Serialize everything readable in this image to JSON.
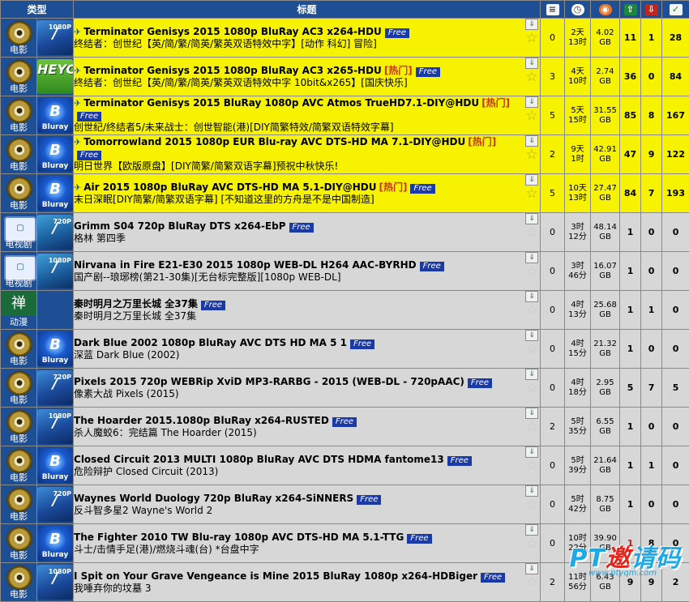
{
  "header": {
    "type_label": "类型",
    "title_label": "标题",
    "icon_names": [
      "comments-icon",
      "time-icon",
      "size-icon",
      "seeders-icon",
      "leechers-icon",
      "completed-icon"
    ]
  },
  "free_label": "Free",
  "hot_label": "[热门]",
  "rows": [
    {
      "style": "sticky",
      "cat": "movie",
      "cat_label": "电影",
      "fmt": "movies",
      "fmt_text": "1080P",
      "pinned": true,
      "title": "Terminator Genisys 2015 1080p BluRay AC3 x264-HDU",
      "hot": false,
      "free": true,
      "subtitle": "终结者：创世纪【英/简/繁/简英/繁英双语特效中字】[动作 科幻] 冒险]",
      "comments": "0",
      "time1": "2天",
      "time2": "13时",
      "size1": "4.02",
      "size2": "GB",
      "seeders": "11",
      "leechers": "1",
      "completed": "28"
    },
    {
      "style": "sticky",
      "cat": "movie",
      "cat_label": "电影",
      "fmt": "heyc",
      "fmt_text": "HEYC",
      "pinned": true,
      "title": "Terminator Genisys 2015 1080p BluRay AC3 x265-HDU",
      "hot": true,
      "free": true,
      "subtitle": "终结者：创世纪【英/简/繁/简英/繁英双语特效中字 10bit&x265】[国庆快乐]",
      "comments": "3",
      "time1": "4天",
      "time2": "10时",
      "size1": "2.74",
      "size2": "GB",
      "seeders": "36",
      "leechers": "0",
      "completed": "84"
    },
    {
      "style": "sticky",
      "cat": "movie",
      "cat_label": "电影",
      "fmt": "bluray",
      "fmt_text": "Bluray",
      "pinned": true,
      "title": "Terminator Genisys 2015 BluRay 1080p AVC Atmos TrueHD7.1-DIY@HDU",
      "hot": true,
      "free": true,
      "subtitle": "创世纪/终结者5/未来战士：创世智能(港)[DIY简繁特效/简繁双语特效字幕]",
      "comments": "5",
      "time1": "5天",
      "time2": "15时",
      "size1": "31.55",
      "size2": "GB",
      "seeders": "85",
      "leechers": "8",
      "completed": "167"
    },
    {
      "style": "sticky",
      "cat": "movie",
      "cat_label": "电影",
      "fmt": "bluray",
      "fmt_text": "Bluray",
      "pinned": true,
      "title": "Tomorrowland 2015 1080p EUR Blu-ray AVC DTS-HD MA 7.1-DIY@HDU",
      "hot": true,
      "free": true,
      "subtitle": "明日世界【欧版原盘】[DIY简繁/简繁双语字幕]预祝中秋快乐!",
      "comments": "2",
      "time1": "9天",
      "time2": "1时",
      "size1": "42.91",
      "size2": "GB",
      "seeders": "47",
      "leechers": "9",
      "completed": "122"
    },
    {
      "style": "sticky",
      "cat": "movie",
      "cat_label": "电影",
      "fmt": "bluray",
      "fmt_text": "Bluray",
      "pinned": true,
      "title": "Air 2015 1080p BluRay AVC DTS-HD MA 5.1-DIY@HDU",
      "hot": true,
      "free": true,
      "subtitle": "末日深眠[DIY简繁/简繁双语字幕] [不知道这里的方舟是不是中国制造]",
      "comments": "5",
      "time1": "10天",
      "time2": "13时",
      "size1": "27.47",
      "size2": "GB",
      "seeders": "84",
      "leechers": "7",
      "completed": "193"
    },
    {
      "style": "normal",
      "cat": "tv",
      "cat_label": "电视剧",
      "fmt": "tv",
      "fmt_text": "720P",
      "pinned": false,
      "title": "Grimm S04 720p BluRay DTS x264-EbP",
      "hot": false,
      "free": true,
      "subtitle": "格林 第四季",
      "comments": "0",
      "time1": "3时",
      "time2": "12分",
      "size1": "48.14",
      "size2": "GB",
      "seeders": "1",
      "leechers": "0",
      "completed": "0"
    },
    {
      "style": "normal",
      "cat": "tv",
      "cat_label": "电视剧",
      "fmt": "tv",
      "fmt_text": "1080P",
      "pinned": false,
      "title": "Nirvana in Fire E21-E30 2015 1080p WEB-DL H264 AAC-BYRHD",
      "hot": false,
      "free": true,
      "subtitle": "国产剧--琅琊榜(第21-30集)[无台标完整版][1080p WEB-DL]",
      "comments": "0",
      "time1": "3时",
      "time2": "46分",
      "size1": "16.07",
      "size2": "GB",
      "seeders": "1",
      "leechers": "0",
      "completed": "0"
    },
    {
      "style": "normal",
      "cat": "anime",
      "cat_label": "动漫",
      "cat_char": "禅",
      "fmt": "blank",
      "fmt_text": "",
      "pinned": false,
      "title": "秦时明月之万里长城 全37集",
      "hot": false,
      "free": true,
      "subtitle": "秦时明月之万里长城 全37集",
      "comments": "0",
      "time1": "4时",
      "time2": "13分",
      "size1": "25.68",
      "size2": "GB",
      "seeders": "1",
      "leechers": "1",
      "completed": "0"
    },
    {
      "style": "normal",
      "cat": "movie",
      "cat_label": "电影",
      "fmt": "bluray",
      "fmt_text": "Bluray",
      "pinned": false,
      "title": "Dark Blue 2002 1080p BluRay AVC DTS HD MA 5 1",
      "hot": false,
      "free": true,
      "subtitle": "深蓝 Dark Blue (2002)",
      "comments": "0",
      "time1": "4时",
      "time2": "15分",
      "size1": "21.32",
      "size2": "GB",
      "seeders": "1",
      "leechers": "0",
      "completed": "0"
    },
    {
      "style": "normal",
      "cat": "movie",
      "cat_label": "电影",
      "fmt": "movies",
      "fmt_text": "720P",
      "pinned": false,
      "title": "Pixels 2015 720p WEBRip XviD MP3-RARBG - 2015 (WEB-DL - 720pAAC)",
      "hot": false,
      "free": true,
      "subtitle": "像素大战 Pixels (2015)",
      "comments": "0",
      "time1": "4时",
      "time2": "18分",
      "size1": "2.95",
      "size2": "GB",
      "seeders": "5",
      "leechers": "7",
      "completed": "5"
    },
    {
      "style": "normal",
      "cat": "movie",
      "cat_label": "电影",
      "fmt": "movies",
      "fmt_text": "1080P",
      "pinned": false,
      "title": "The Hoarder 2015.1080p BluRay x264-RUSTED",
      "hot": false,
      "free": true,
      "subtitle": "杀人魔蛟6：完结篇 The Hoarder (2015)",
      "comments": "2",
      "time1": "5时",
      "time2": "35分",
      "size1": "6.55",
      "size2": "GB",
      "seeders": "1",
      "leechers": "0",
      "completed": "0"
    },
    {
      "style": "normal",
      "cat": "movie",
      "cat_label": "电影",
      "fmt": "bluray",
      "fmt_text": "Bluray",
      "pinned": false,
      "title": "Closed Circuit 2013 MULTI 1080p BluRay AVC DTS HDMA fantome13",
      "hot": false,
      "free": true,
      "subtitle": "危险辩护 Closed Circuit (2013)",
      "comments": "0",
      "time1": "5时",
      "time2": "39分",
      "size1": "21.64",
      "size2": "GB",
      "seeders": "1",
      "leechers": "1",
      "completed": "0"
    },
    {
      "style": "normal",
      "cat": "movie",
      "cat_label": "电影",
      "fmt": "movies",
      "fmt_text": "720P",
      "pinned": false,
      "title": "Waynes World Duology 720p BluRay x264-SiNNERS",
      "hot": false,
      "free": true,
      "subtitle": "反斗智多星2 Wayne's World 2",
      "comments": "0",
      "time1": "5时",
      "time2": "42分",
      "size1": "8.75",
      "size2": "GB",
      "seeders": "1",
      "leechers": "0",
      "completed": "0"
    },
    {
      "style": "normal",
      "cat": "movie",
      "cat_label": "电影",
      "fmt": "bluray",
      "fmt_text": "Bluray",
      "pinned": false,
      "title": "The Fighter 2010 TW Blu-ray 1080p AVC DTS-HD MA 5.1-TTG",
      "hot": false,
      "free": true,
      "subtitle": "斗士/击情手足(港)/燃烧斗魂(台) *台盘中字",
      "comments": "0",
      "time1": "10时",
      "time2": "22分",
      "size1": "39.90",
      "size2": "GB",
      "seeders": "1",
      "seeders_red": true,
      "leechers": "8",
      "completed": "0"
    },
    {
      "style": "normal",
      "cat": "movie",
      "cat_label": "电影",
      "fmt": "movies",
      "fmt_text": "1080P",
      "pinned": false,
      "title": "I Spit on Your Grave Vengeance is Mine 2015 BluRay 1080p x264-HDBiger",
      "hot": false,
      "free": true,
      "subtitle": "我唾弃你的坟墓 3",
      "comments": "2",
      "time1": "11时",
      "time2": "56分",
      "size1": "6.43",
      "size2": "GB",
      "seeders": "9",
      "leechers": "9",
      "completed": "2"
    }
  ],
  "watermark": {
    "brand_left": "PT",
    "brand_mid": "邀",
    "brand_right": "请码",
    "url": "www.ptyqm.com"
  }
}
